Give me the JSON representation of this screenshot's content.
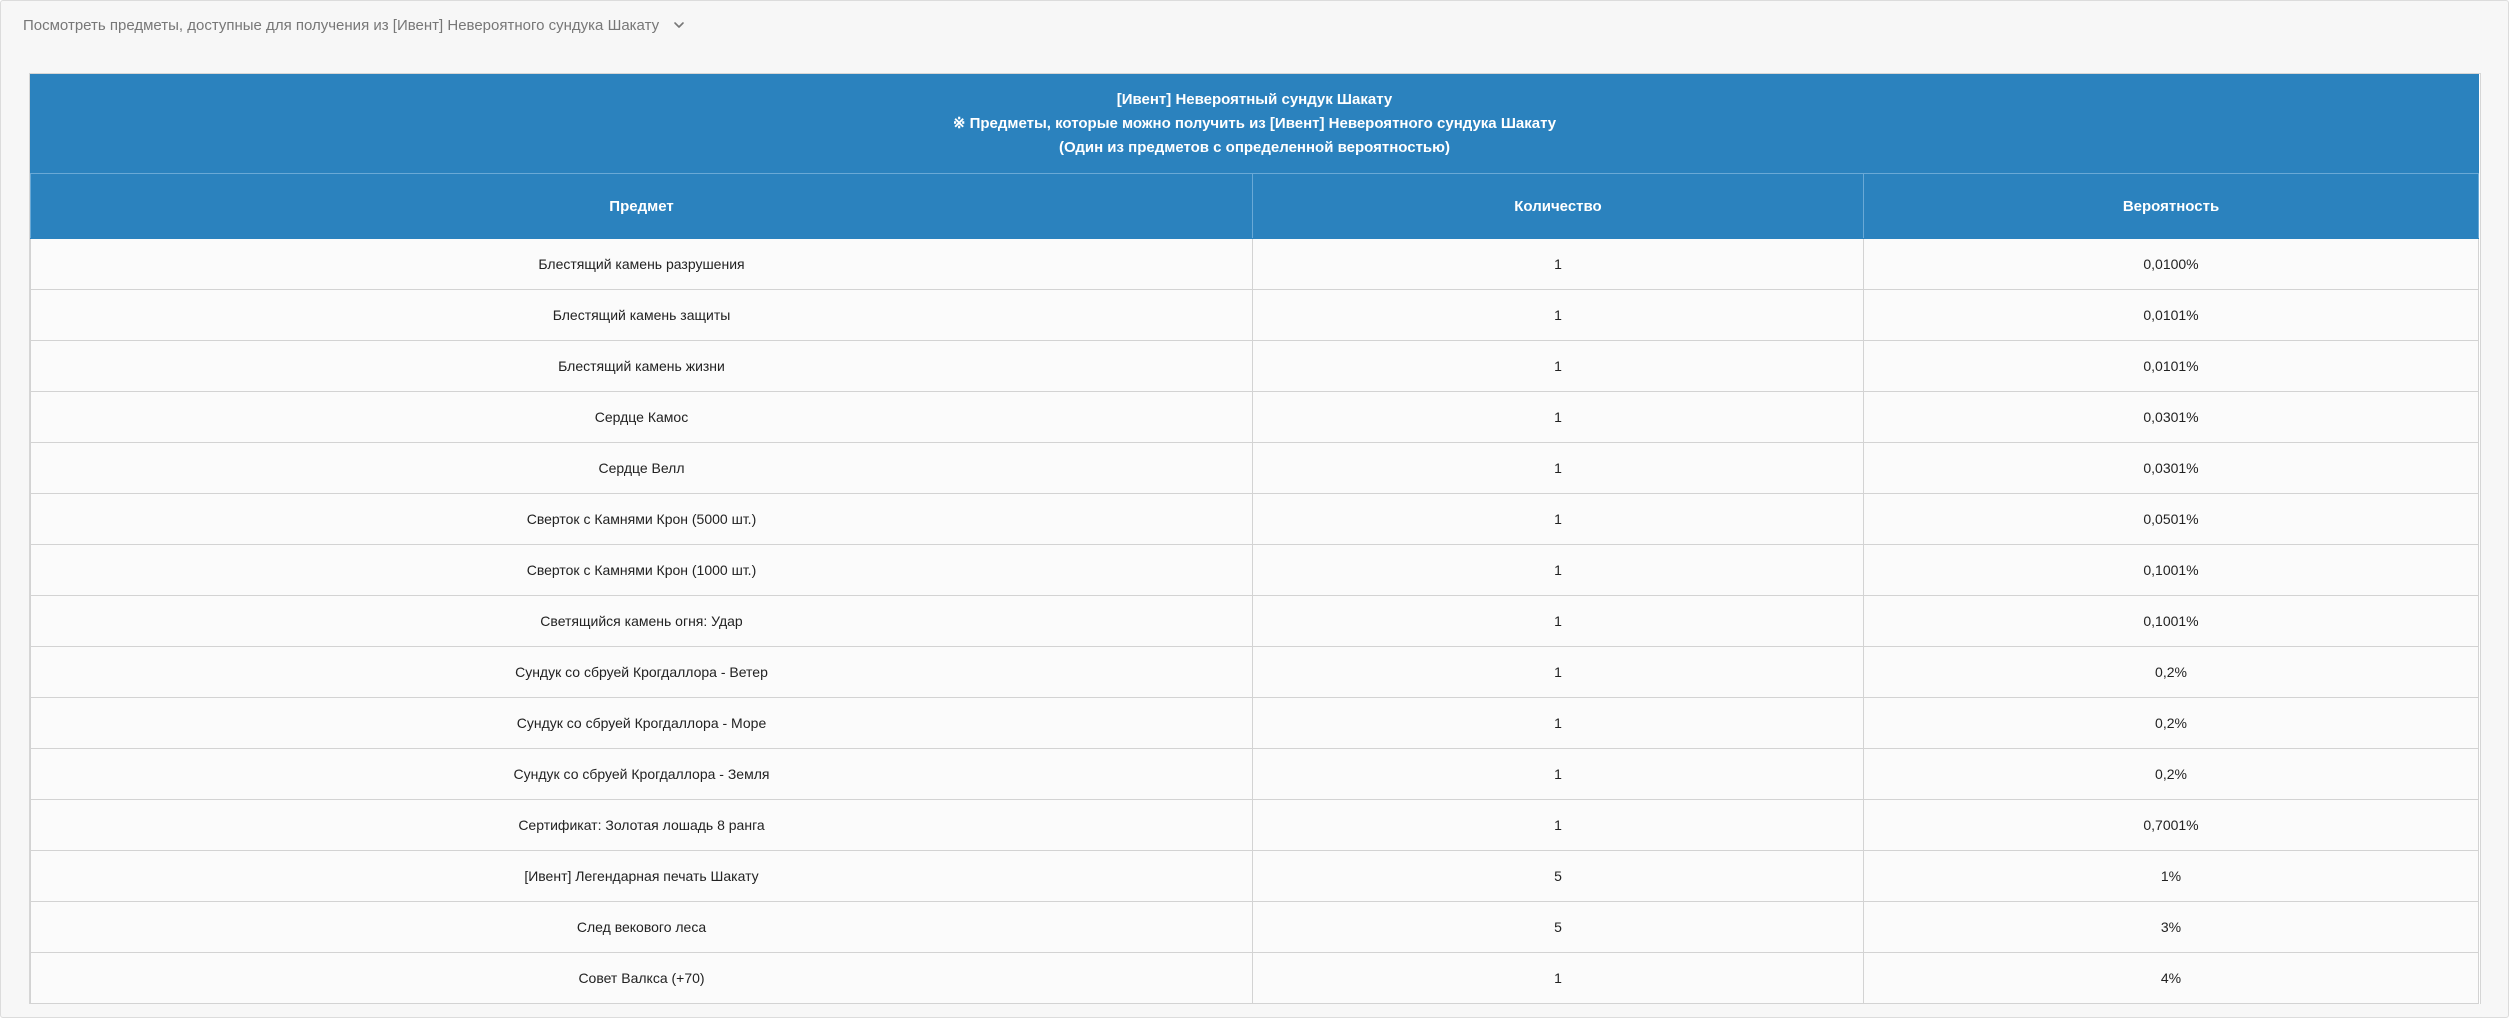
{
  "toggle": {
    "label": "Посмотреть предметы, доступные для получения из [Ивент] Невероятного сундука Шакату",
    "icon": "chevron-down-icon"
  },
  "table": {
    "title_lines": [
      "[Ивент] Невероятный сундук Шакату",
      "※ Предметы, которые можно получить из [Ивент] Невероятного сундука Шакату",
      "(Один из предметов с определенной вероятностью)"
    ],
    "columns": [
      "Предмет",
      "Количество",
      "Вероятность"
    ],
    "rows": [
      {
        "item": "Блестящий камень разрушения",
        "qty": "1",
        "prob": "0,0100%"
      },
      {
        "item": "Блестящий камень защиты",
        "qty": "1",
        "prob": "0,0101%"
      },
      {
        "item": "Блестящий камень жизни",
        "qty": "1",
        "prob": "0,0101%"
      },
      {
        "item": "Сердце Камос",
        "qty": "1",
        "prob": "0,0301%"
      },
      {
        "item": "Сердце Велл",
        "qty": "1",
        "prob": "0,0301%"
      },
      {
        "item": "Сверток с Камнями Крон (5000 шт.)",
        "qty": "1",
        "prob": "0,0501%"
      },
      {
        "item": "Сверток с Камнями Крон (1000 шт.)",
        "qty": "1",
        "prob": "0,1001%"
      },
      {
        "item": "Светящийся камень огня: Удар",
        "qty": "1",
        "prob": "0,1001%"
      },
      {
        "item": "Сундук со сбруей Крогдаллора - Ветер",
        "qty": "1",
        "prob": "0,2%"
      },
      {
        "item": "Сундук со сбруей Крогдаллора - Море",
        "qty": "1",
        "prob": "0,2%"
      },
      {
        "item": "Сундук со сбруей Крогдаллора - Земля",
        "qty": "1",
        "prob": "0,2%"
      },
      {
        "item": "Сертификат: Золотая лошадь 8 ранга",
        "qty": "1",
        "prob": "0,7001%"
      },
      {
        "item": "[Ивент] Легендарная печать Шакату",
        "qty": "5",
        "prob": "1%"
      },
      {
        "item": "След векового леса",
        "qty": "5",
        "prob": "3%"
      },
      {
        "item": "Совет Валкса (+70)",
        "qty": "1",
        "prob": "4%"
      }
    ]
  },
  "colors": {
    "header_bg": "#2b82be",
    "header_text": "#ffffff",
    "toggle_text": "#777777"
  }
}
